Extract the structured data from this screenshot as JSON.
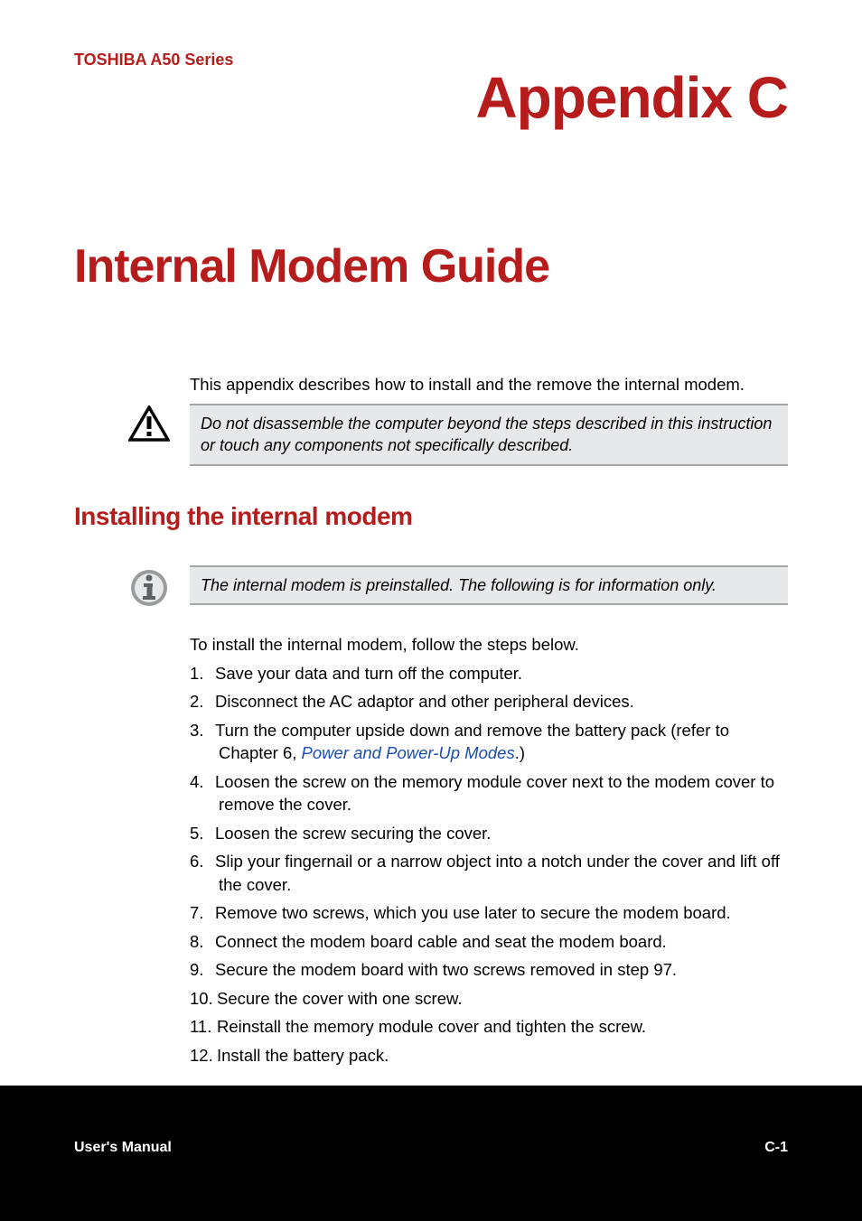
{
  "header": {
    "series": "TOSHIBA A50 Series",
    "appendix": "Appendix C"
  },
  "title": "Internal Modem Guide",
  "intro": "This appendix describes how to install and the remove the internal modem.",
  "caution": {
    "text": "Do not disassemble the computer beyond the steps described in this instruction or touch any components not specifically described."
  },
  "section": {
    "title": "Installing the internal modem"
  },
  "info": {
    "text": "The internal modem is preinstalled. The following is for information only."
  },
  "install_intro": "To install the internal modem, follow the steps below.",
  "steps": [
    {
      "num": "1.",
      "text": "Save your data and turn off the computer."
    },
    {
      "num": "2.",
      "text": "Disconnect the AC adaptor and other peripheral devices."
    },
    {
      "num": "3.",
      "text_pre": "Turn the computer upside down and remove the battery pack (refer to Chapter 6, ",
      "link": "Power and Power-Up Modes",
      "text_post": ".)"
    },
    {
      "num": "4.",
      "text": "Loosen the screw on the memory module cover next to the modem cover to remove the cover."
    },
    {
      "num": "5.",
      "text": "Loosen the screw securing the cover."
    },
    {
      "num": "6.",
      "text": "Slip your fingernail or a narrow object into a notch under the cover and lift off the cover."
    },
    {
      "num": "7.",
      "text": "Remove two screws, which you use later to secure the modem board."
    },
    {
      "num": "8.",
      "text": "Connect the modem board cable and seat the modem board."
    },
    {
      "num": "9.",
      "text": "Secure the modem board with two screws removed in step 97."
    },
    {
      "num": "10.",
      "text": "Secure the cover with one screw."
    },
    {
      "num": "11.",
      "text": "Reinstall the memory module cover and tighten the screw."
    },
    {
      "num": "12.",
      "text": "Install the battery pack."
    }
  ],
  "footer": {
    "left": "User's Manual",
    "right": "C-1"
  }
}
